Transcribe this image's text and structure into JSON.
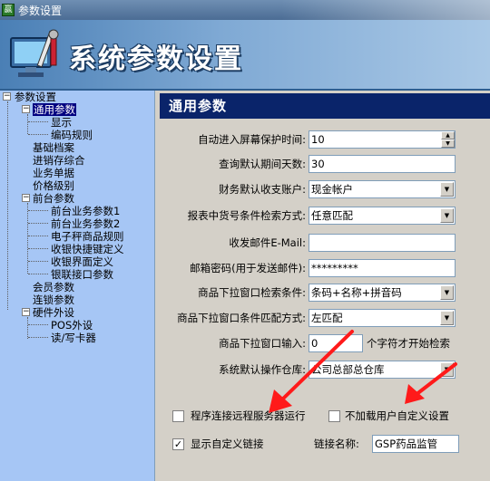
{
  "window": {
    "title": "参数设置",
    "icon": "app-icon"
  },
  "banner": {
    "heading": "系统参数设置",
    "icon": "computer-tools-icon"
  },
  "tree": {
    "items": [
      {
        "label": "参数设置"
      },
      {
        "label": "通用参数"
      },
      {
        "label": "显示"
      },
      {
        "label": "编码规则"
      },
      {
        "label": "基础档案"
      },
      {
        "label": "进销存综合"
      },
      {
        "label": "业务单据"
      },
      {
        "label": "价格级别"
      },
      {
        "label": "前台参数"
      },
      {
        "label": "前台业务参数1"
      },
      {
        "label": "前台业务参数2"
      },
      {
        "label": "电子秤商品规则"
      },
      {
        "label": "收银快捷键定义"
      },
      {
        "label": "收银界面定义"
      },
      {
        "label": "银联接口参数"
      },
      {
        "label": "会员参数"
      },
      {
        "label": "连锁参数"
      },
      {
        "label": "硬件外设"
      },
      {
        "label": "POS外设"
      },
      {
        "label": "读/写卡器"
      }
    ]
  },
  "section": {
    "title": "通用参数"
  },
  "fields": {
    "screen_saver": {
      "label": "自动进入屏幕保护时间:",
      "value": "10"
    },
    "query_days": {
      "label": "查询默认期间天数:",
      "value": "30"
    },
    "account": {
      "label": "财务默认收支账户:",
      "value": "现金帐户"
    },
    "report_filter": {
      "label": "报表中货号条件检索方式:",
      "value": "任意匹配"
    },
    "email": {
      "label": "收发邮件E-Mail:",
      "value": ""
    },
    "email_pwd": {
      "label": "邮箱密码(用于发送邮件):",
      "value": "*********"
    },
    "dropdown_search": {
      "label": "商品下拉窗口检索条件:",
      "value": "条码+名称+拼音码"
    },
    "dropdown_match": {
      "label": "商品下拉窗口条件匹配方式:",
      "value": "左匹配"
    },
    "dropdown_input": {
      "label": "商品下拉窗口输入:",
      "value": "0",
      "suffix": "个字符才开始检索"
    },
    "warehouse": {
      "label": "系统默认操作仓库:",
      "value": "公司总部总仓库"
    }
  },
  "checkboxes": {
    "remote_server": {
      "label": "程序连接远程服务器运行",
      "checked": false
    },
    "no_custom": {
      "label": "不加载用户自定义设置",
      "checked": false
    },
    "custom_link": {
      "label": "显示自定义链接",
      "checked": true
    }
  },
  "link_name": {
    "label": "链接名称:",
    "value": "GSP药品监管"
  },
  "annotation_color": "#ff1a1a"
}
